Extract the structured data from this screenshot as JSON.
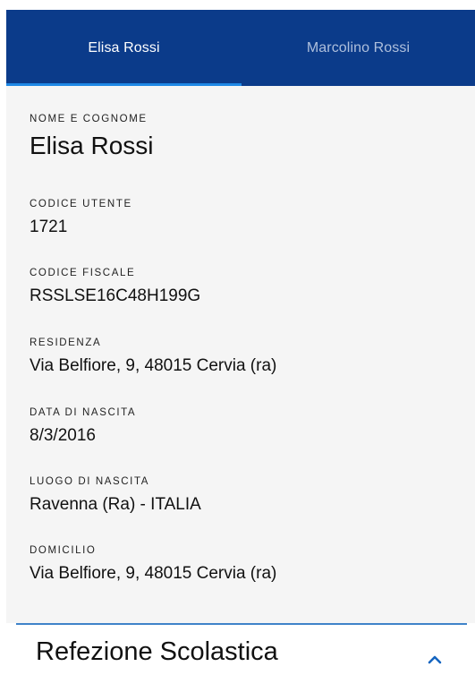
{
  "tabs": [
    {
      "label": "Elisa Rossi",
      "active": true
    },
    {
      "label": "Marcolino Rossi",
      "active": false
    }
  ],
  "profile": {
    "nome_e_cognome": {
      "label": "NOME E COGNOME",
      "value": "Elisa Rossi"
    },
    "codice_utente": {
      "label": "CODICE UTENTE",
      "value": "1721"
    },
    "codice_fiscale": {
      "label": "CODICE FISCALE",
      "value": "RSSLSE16C48H199G"
    },
    "residenza": {
      "label": "RESIDENZA",
      "value": "Via Belfiore, 9, 48015 Cervia (ra)"
    },
    "data_di_nascita": {
      "label": "DATA DI NASCITA",
      "value": "8/3/2016"
    },
    "luogo_di_nascita": {
      "label": "LUOGO DI NASCITA",
      "value": "Ravenna (Ra) - ITALIA"
    },
    "domicilio": {
      "label": "DOMICILIO",
      "value": "Via Belfiore, 9, 48015 Cervia (ra)"
    }
  },
  "section": {
    "title": "Refezione Scolastica",
    "expanded": true,
    "icon": "chevron-up-icon"
  },
  "colors": {
    "tabbar": "#0b3b8a",
    "tab_indicator": "#1e88e5",
    "panel_bg": "#f5f5f5",
    "divider": "#3f83c9",
    "chevron": "#1565c0"
  }
}
